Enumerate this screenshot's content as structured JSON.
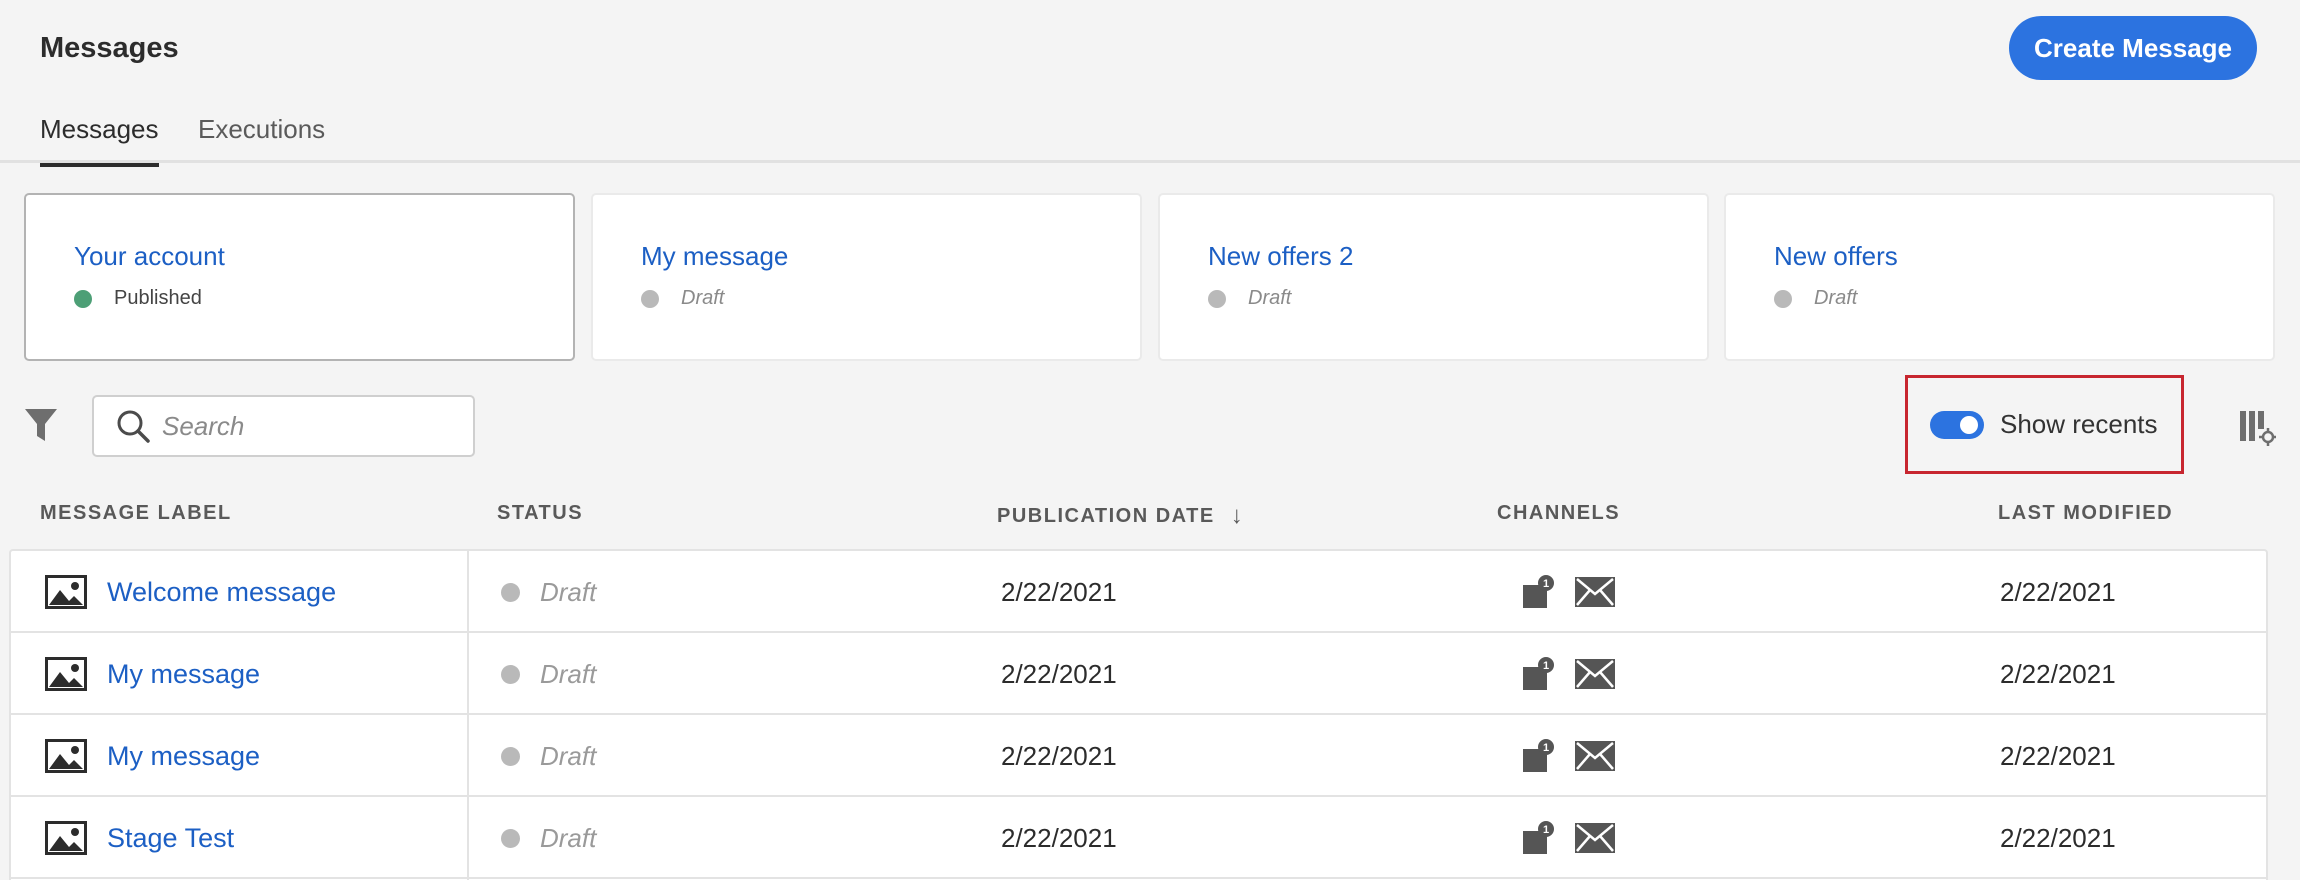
{
  "header": {
    "title": "Messages",
    "create_button": "Create Message"
  },
  "tabs": [
    {
      "label": "Messages",
      "active": true
    },
    {
      "label": "Executions",
      "active": false
    }
  ],
  "recent_cards": [
    {
      "title": "Your account",
      "status": "Published"
    },
    {
      "title": "My message",
      "status": "Draft"
    },
    {
      "title": "New offers 2",
      "status": "Draft"
    },
    {
      "title": "New offers",
      "status": "Draft"
    }
  ],
  "toolbar": {
    "search_placeholder": "Search",
    "show_recents_label": "Show recents",
    "show_recents_on": true
  },
  "table": {
    "columns": [
      "MESSAGE LABEL",
      "STATUS",
      "PUBLICATION DATE",
      "CHANNELS",
      "LAST MODIFIED"
    ],
    "sort_indicator": "↓",
    "rows": [
      {
        "label": "Welcome message",
        "status": "Draft",
        "publication_date": "2/22/2021",
        "push_badge": "1",
        "last_modified": "2/22/2021"
      },
      {
        "label": "My message",
        "status": "Draft",
        "publication_date": "2/22/2021",
        "push_badge": "1",
        "last_modified": "2/22/2021"
      },
      {
        "label": "My message",
        "status": "Draft",
        "publication_date": "2/22/2021",
        "push_badge": "1",
        "last_modified": "2/22/2021"
      },
      {
        "label": "Stage Test",
        "status": "Draft",
        "publication_date": "2/22/2021",
        "push_badge": "1",
        "last_modified": "2/22/2021"
      }
    ]
  },
  "colors": {
    "accent": "#2c73e0",
    "link": "#1c5fc4",
    "published": "#4d9f76",
    "draft": "#b9b9b9",
    "highlight_border": "#c7262f"
  },
  "icons": [
    "filter-icon",
    "search-icon",
    "column-settings-icon",
    "image-thumbnail-icon",
    "push-notification-icon",
    "email-icon",
    "sort-arrow-icon"
  ]
}
